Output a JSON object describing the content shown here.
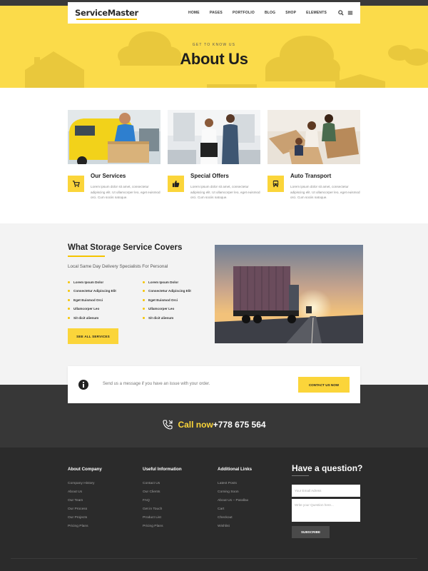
{
  "header": {
    "logo": "ServiceMaster",
    "nav": [
      "HOME",
      "PAGES",
      "PORTFOLIO",
      "BLOG",
      "SHOP",
      "ELEMENTS"
    ],
    "icons": [
      "search-icon",
      "menu-icon"
    ]
  },
  "hero": {
    "kicker": "GET TO KNOW US",
    "title": "About Us"
  },
  "services": [
    {
      "title": "Our Services",
      "icon": "cart-icon",
      "text": "Lorem ipsum dolor sit amet, consectetur adipiscing elit. Ut ullamcorper leo, eget euismod orci. Cum sociis natoque."
    },
    {
      "title": "Special Offers",
      "icon": "thumbs-up-icon",
      "text": "Lorem ipsum dolor sit amet, consectetur adipiscing elit. Ut ullamcorper leo, eget euismod orci. Cum sociis natoque."
    },
    {
      "title": "Auto Transport",
      "icon": "bus-icon",
      "text": "Lorem ipsum dolor sit amet, consectetur adipiscing elit. Ut ullamcorper leo, eget euismod orci. Cum sociis natoque."
    }
  ],
  "storage": {
    "title": "What Storage Service Covers",
    "subtitle": "Local Same Day Delivery Specialists For Personal",
    "col1": [
      "Lorem Ipsum Dolor",
      "Consectetur Adipiscing Elit",
      "Eget Euismod Orci",
      "Ullamcorper Leo",
      "Sit dicit alienum"
    ],
    "col2": [
      "Lorem Ipsum Dolor",
      "Consectetur Adipiscing Elit",
      "Eget Euismod Orci",
      "Ullamcorper Leo",
      "Sit dicit alienum"
    ],
    "button": "SEE ALL SERVICES"
  },
  "contact": {
    "icon": "info-icon",
    "message": "Send us a message if you have an issue with your order.",
    "button": "CONTACT US NOW",
    "call_label": "Call now",
    "phone": "+778 675 564"
  },
  "footer": {
    "col1": {
      "title": "About Company",
      "links": [
        "Company History",
        "About Us",
        "Our Team",
        "Our Process",
        "Our Projects",
        "Pricing Plans"
      ]
    },
    "col2": {
      "title": "Useful Information",
      "links": [
        "Contact Us",
        "Our Clients",
        "FAQ",
        "Get in Touch",
        "Product List",
        "Pricing Plans"
      ]
    },
    "col3": {
      "title": "Additional Links",
      "links": [
        "Latest Posts",
        "Coming Soon",
        "About Us – Parallax",
        "Cart",
        "Checkout",
        "Wishlist"
      ]
    },
    "question": {
      "title": "Have a question?",
      "email_placeholder": "Your Email Adress",
      "question_placeholder": "Write your Question here...",
      "button": "SUBSCRIBE"
    }
  },
  "colors": {
    "accent": "#fbd53a",
    "dark": "#373737",
    "footer": "#2b2b2b"
  }
}
